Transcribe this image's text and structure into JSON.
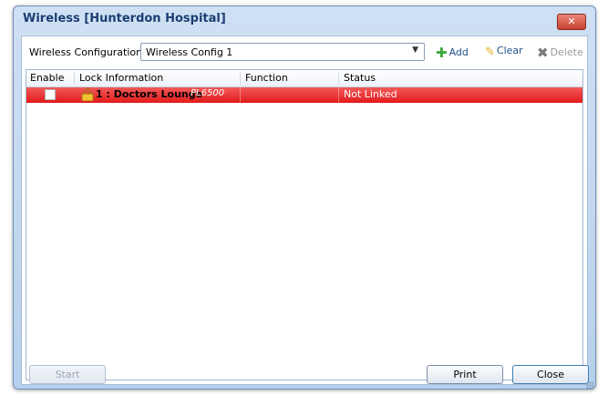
{
  "window": {
    "title": "Wireless [Hunterdon Hospital]",
    "close_glyph": "✕"
  },
  "toolbar": {
    "config_label": "Wireless Configuration:",
    "config_value": "Wireless Config 1",
    "add_label": "Add",
    "clear_label": "Clear",
    "delete_label": "Delete",
    "add_icon": "plus-icon",
    "clear_icon": "broom-icon",
    "delete_icon": "x-icon"
  },
  "grid": {
    "columns": [
      "Enable",
      "Lock Information",
      "Function",
      "Status"
    ],
    "rows": [
      {
        "enabled": false,
        "lock_name": "1 : Doctors Lounge",
        "lock_model": "PL6500",
        "function": "",
        "status": "Not Linked",
        "row_color": "#e53030"
      }
    ]
  },
  "footer": {
    "start_label": "Start",
    "print_label": "Print",
    "close_label": "Close"
  }
}
